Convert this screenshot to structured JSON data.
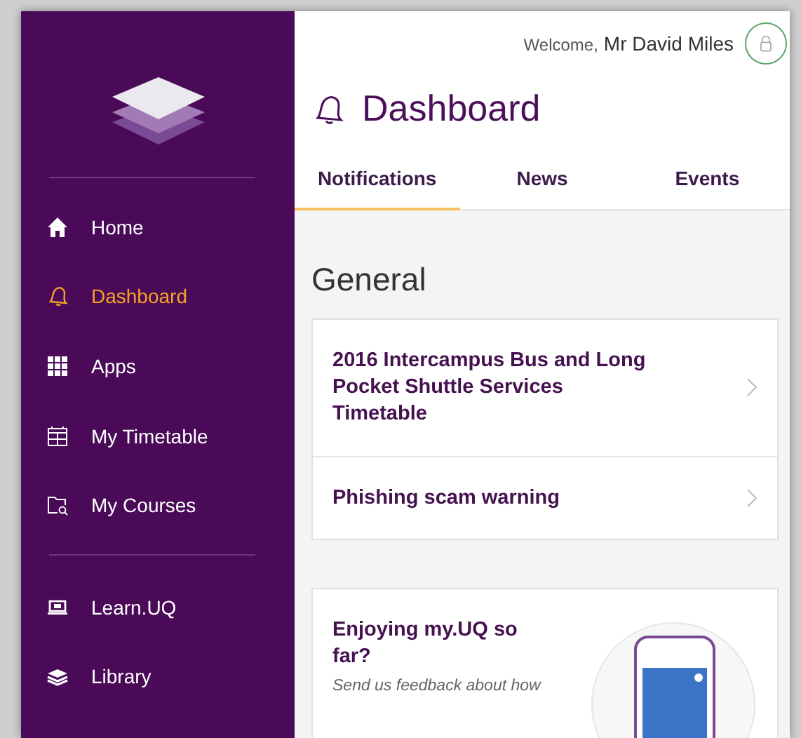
{
  "header": {
    "welcome": "Welcome,",
    "user_name": "Mr David Miles"
  },
  "sidebar": {
    "primary_items": [
      {
        "label": "Home",
        "selected": false
      },
      {
        "label": "Dashboard",
        "selected": true
      },
      {
        "label": "Apps",
        "selected": false
      },
      {
        "label": "My Timetable",
        "selected": false
      },
      {
        "label": "My Courses",
        "selected": false
      }
    ],
    "secondary_items": [
      {
        "label": "Learn.UQ",
        "selected": false
      },
      {
        "label": "Library",
        "selected": false
      }
    ]
  },
  "page_title": "Dashboard",
  "tabs": [
    {
      "label": "Notifications",
      "selected": true
    },
    {
      "label": "News",
      "selected": false
    },
    {
      "label": "Events",
      "selected": false
    }
  ],
  "section_title": "General",
  "notifications": [
    {
      "title": "2016 Intercampus Bus and Long Pocket Shuttle Services Timetable"
    },
    {
      "title": "Phishing scam warning"
    }
  ],
  "feedback": {
    "title": "Enjoying my.UQ so far?",
    "text": "Send us feedback about how"
  }
}
